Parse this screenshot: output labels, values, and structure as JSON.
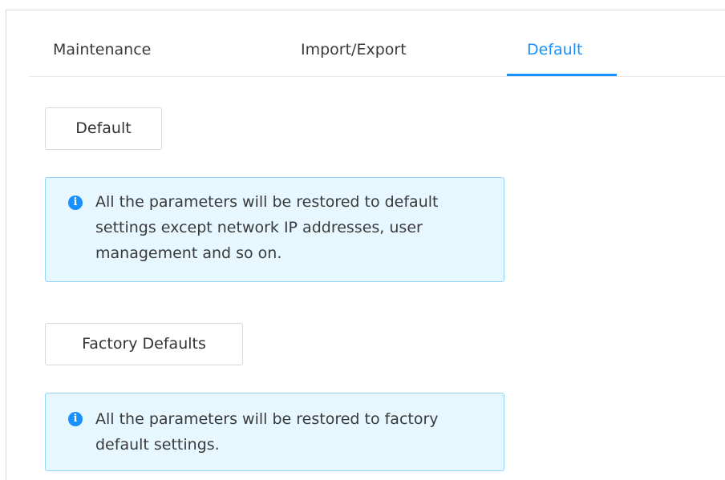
{
  "tabs": [
    {
      "label": "Maintenance",
      "active": false
    },
    {
      "label": "Import/Export",
      "active": false
    },
    {
      "label": "Default",
      "active": true
    }
  ],
  "default_section": {
    "button_label": "Default",
    "notice_text": "All the parameters will be restored to default settings except network IP addresses, user management and so on."
  },
  "factory_section": {
    "button_label": "Factory Defaults",
    "notice_text": "All the parameters will be restored to factory default settings."
  },
  "notice_icon": "info-icon",
  "colors": {
    "accent": "#1890ff",
    "notice_background": "#e6f7ff",
    "notice_border": "#91d5ff"
  }
}
